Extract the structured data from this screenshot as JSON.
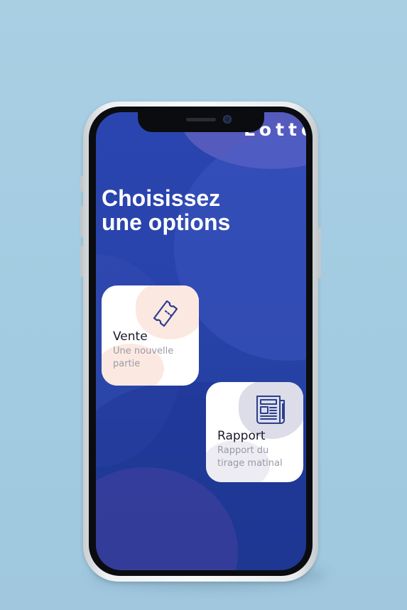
{
  "app": {
    "logo_text": "Lotto",
    "headline_line1": "Choisissez",
    "headline_line2": "une options"
  },
  "options": [
    {
      "title": "Vente",
      "subtitle": "Une nouvelle partie",
      "icon": "ticket-icon"
    },
    {
      "title": "Rapport",
      "subtitle": "Rapport du tirage matinal",
      "icon": "newspaper-icon"
    }
  ],
  "colors": {
    "background": "#a9cfe3",
    "screen": "#2b45b0",
    "card": "#ffffff",
    "icon_stroke": "#2a3f8f",
    "vente_accent": "#fbe9e1",
    "rapport_accent": "#dcdde8"
  }
}
